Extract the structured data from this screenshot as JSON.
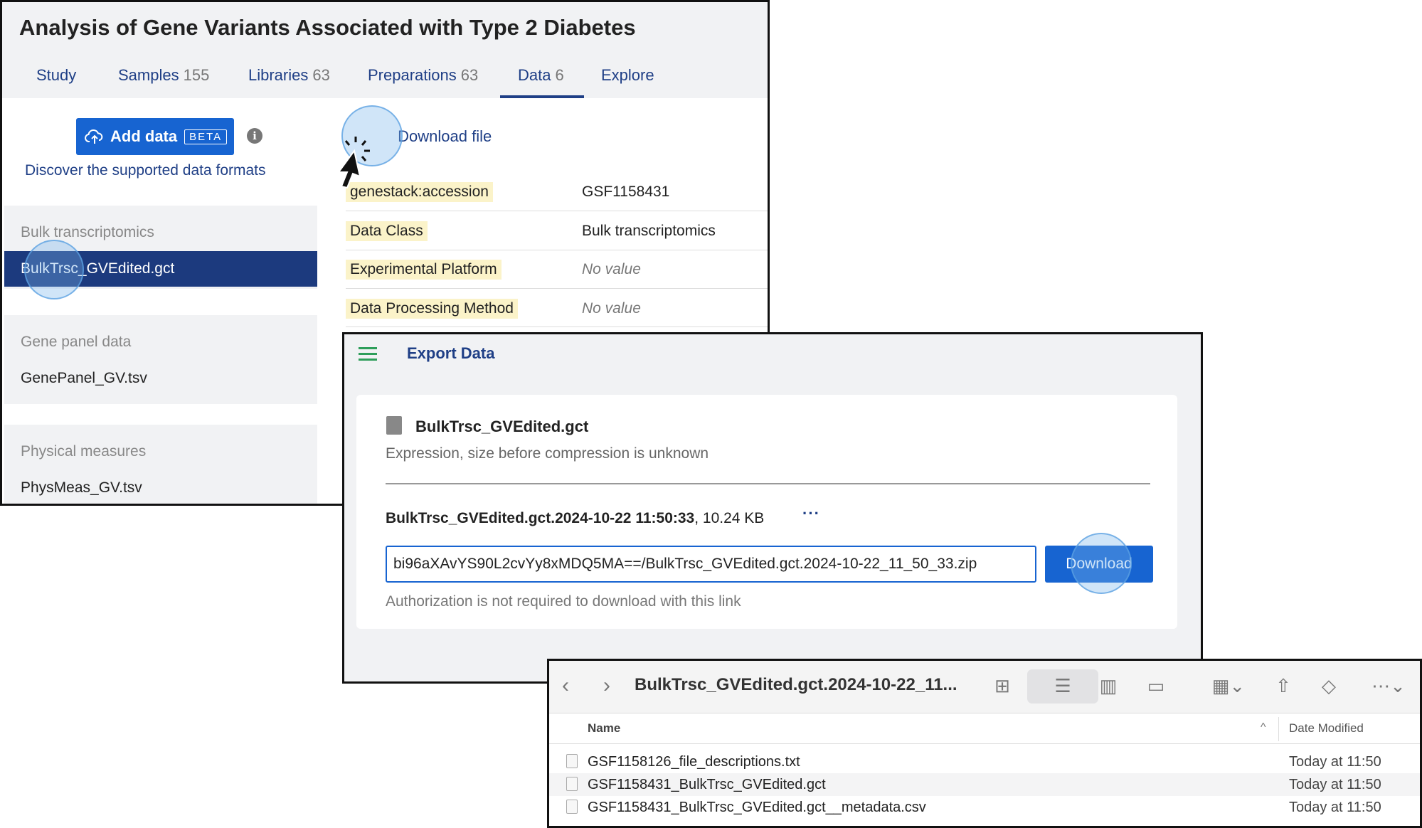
{
  "study": {
    "title": "Analysis of Gene Variants Associated with Type 2 Diabetes",
    "tabs": [
      {
        "label": "Study",
        "count": ""
      },
      {
        "label": "Samples",
        "count": "155"
      },
      {
        "label": "Libraries",
        "count": "63"
      },
      {
        "label": "Preparations",
        "count": "63"
      },
      {
        "label": "Data",
        "count": "6"
      },
      {
        "label": "Explore",
        "count": ""
      }
    ],
    "active_tab": "Data"
  },
  "sidebar": {
    "add_data_label": "Add data",
    "beta_badge": "BETA",
    "discover_link": "Discover the supported data formats",
    "groups": [
      {
        "heading": "Bulk transcriptomics",
        "item": "BulkTrsc_GVEdited.gct"
      },
      {
        "heading": "Gene panel data",
        "item": "GenePanel_GV.tsv"
      },
      {
        "heading": "Physical measures",
        "item": "PhysMeas_GV.tsv"
      }
    ]
  },
  "detail": {
    "download_file_label": "Download file",
    "properties": [
      {
        "key": "genestack:accession",
        "value": "GSF1158431"
      },
      {
        "key": "Data Class",
        "value": "Bulk transcriptomics"
      },
      {
        "key": "Experimental Platform",
        "value": "No value"
      },
      {
        "key": "Data Processing Method",
        "value": "No value"
      }
    ]
  },
  "export": {
    "title": "Export Data",
    "file_name": "BulkTrsc_GVEdited.gct",
    "file_desc": "Expression, size before compression is unknown",
    "version_name": "BulkTrsc_GVEdited.gct.2024-10-22 11:50:33",
    "version_size": ", 10.24 KB",
    "more": "···",
    "url": "bi96aXAvYS90L2cvYy8xMDQ5MA==/BulkTrsc_GVEdited.gct.2024-10-22_11_50_33.zip",
    "download_label": "Download",
    "auth_note": "Authorization is not required to download with this link"
  },
  "finder": {
    "path": "BulkTrsc_GVEdited.gct.2024-10-22_11...",
    "col_name": "Name",
    "col_date": "Date Modified",
    "files": [
      {
        "name": "GSF1158126_file_descriptions.txt",
        "date": "Today at 11:50"
      },
      {
        "name": "GSF1158431_BulkTrsc_GVEdited.gct",
        "date": "Today at 11:50"
      },
      {
        "name": "GSF1158431_BulkTrsc_GVEdited.gct__metadata.csv",
        "date": "Today at 11:50"
      }
    ]
  },
  "colors": {
    "brand_blue": "#1764d1",
    "nav_blue": "#1f3f86",
    "selected_row": "#1c3a7e",
    "key_highlight": "#fbf3c9"
  }
}
